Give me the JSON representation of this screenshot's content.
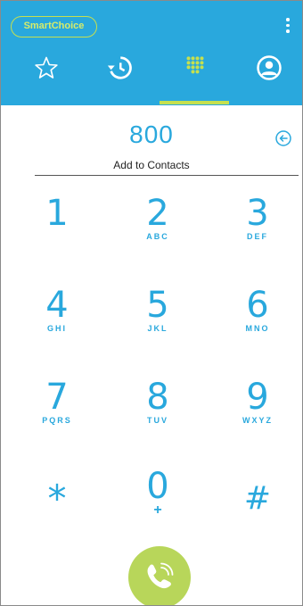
{
  "header": {
    "smartchoice_label": "SmartChoice",
    "menu_icon": "more-vert-icon",
    "tabs": [
      {
        "name": "favorites",
        "icon": "star-icon",
        "active": false
      },
      {
        "name": "recents",
        "icon": "history-icon",
        "active": false
      },
      {
        "name": "dialpad",
        "icon": "dialpad-icon",
        "active": true
      },
      {
        "name": "contacts",
        "icon": "person-circle-icon",
        "active": false
      }
    ]
  },
  "dialer": {
    "number": "800",
    "add_to_contacts": "Add to Contacts",
    "backspace_icon": "backspace-arrow-icon"
  },
  "keypad": {
    "keys": [
      {
        "digit": "1",
        "letters": ""
      },
      {
        "digit": "2",
        "letters": "ABC"
      },
      {
        "digit": "3",
        "letters": "DEF"
      },
      {
        "digit": "4",
        "letters": "GHI"
      },
      {
        "digit": "5",
        "letters": "JKL"
      },
      {
        "digit": "6",
        "letters": "MNO"
      },
      {
        "digit": "7",
        "letters": "PQRS"
      },
      {
        "digit": "8",
        "letters": "TUV"
      },
      {
        "digit": "9",
        "letters": "WXYZ"
      },
      {
        "digit": "*",
        "letters": ""
      },
      {
        "digit": "0",
        "letters": "+"
      },
      {
        "digit": "#",
        "letters": ""
      }
    ]
  },
  "call": {
    "icon": "phone-call-icon"
  },
  "colors": {
    "primary": "#29a8dd",
    "accent": "#c6e04f",
    "call_button": "#b8d65a",
    "background": "#ffffff"
  }
}
